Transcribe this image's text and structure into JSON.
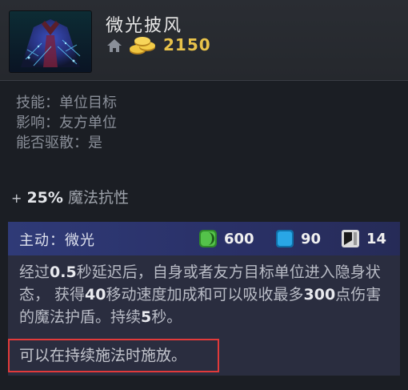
{
  "item": {
    "name": "微光披风",
    "icon": "glimmer-cape",
    "cost": "2150"
  },
  "info": {
    "ability_line": "技能：单位目标",
    "affects_line": "影响：友方单位",
    "dispellable_line": "能否驱散：是"
  },
  "bonus": {
    "plus": "+",
    "value": "25%",
    "label": "魔法抗性"
  },
  "active": {
    "title": "主动：微光",
    "cooldown": "600",
    "mana": "90",
    "charges": "14"
  },
  "description": {
    "p1_a": "经过",
    "p1_b": "0.5",
    "p1_c": "秒延迟后，自身或者友方目标单位进入隐身状态， 获得",
    "p1_d": "40",
    "p1_e": "移动速度加成和可以吸收最多",
    "p1_f": "300",
    "p1_g": "点伤害的魔法护盾。持续",
    "p1_h": "5",
    "p1_i": "秒。",
    "note": "可以在持续施法时施放。"
  },
  "colors": {
    "cost": "#e8c24a",
    "ability_bar": "#2f3a77",
    "highlight_border": "#e23a3a"
  }
}
